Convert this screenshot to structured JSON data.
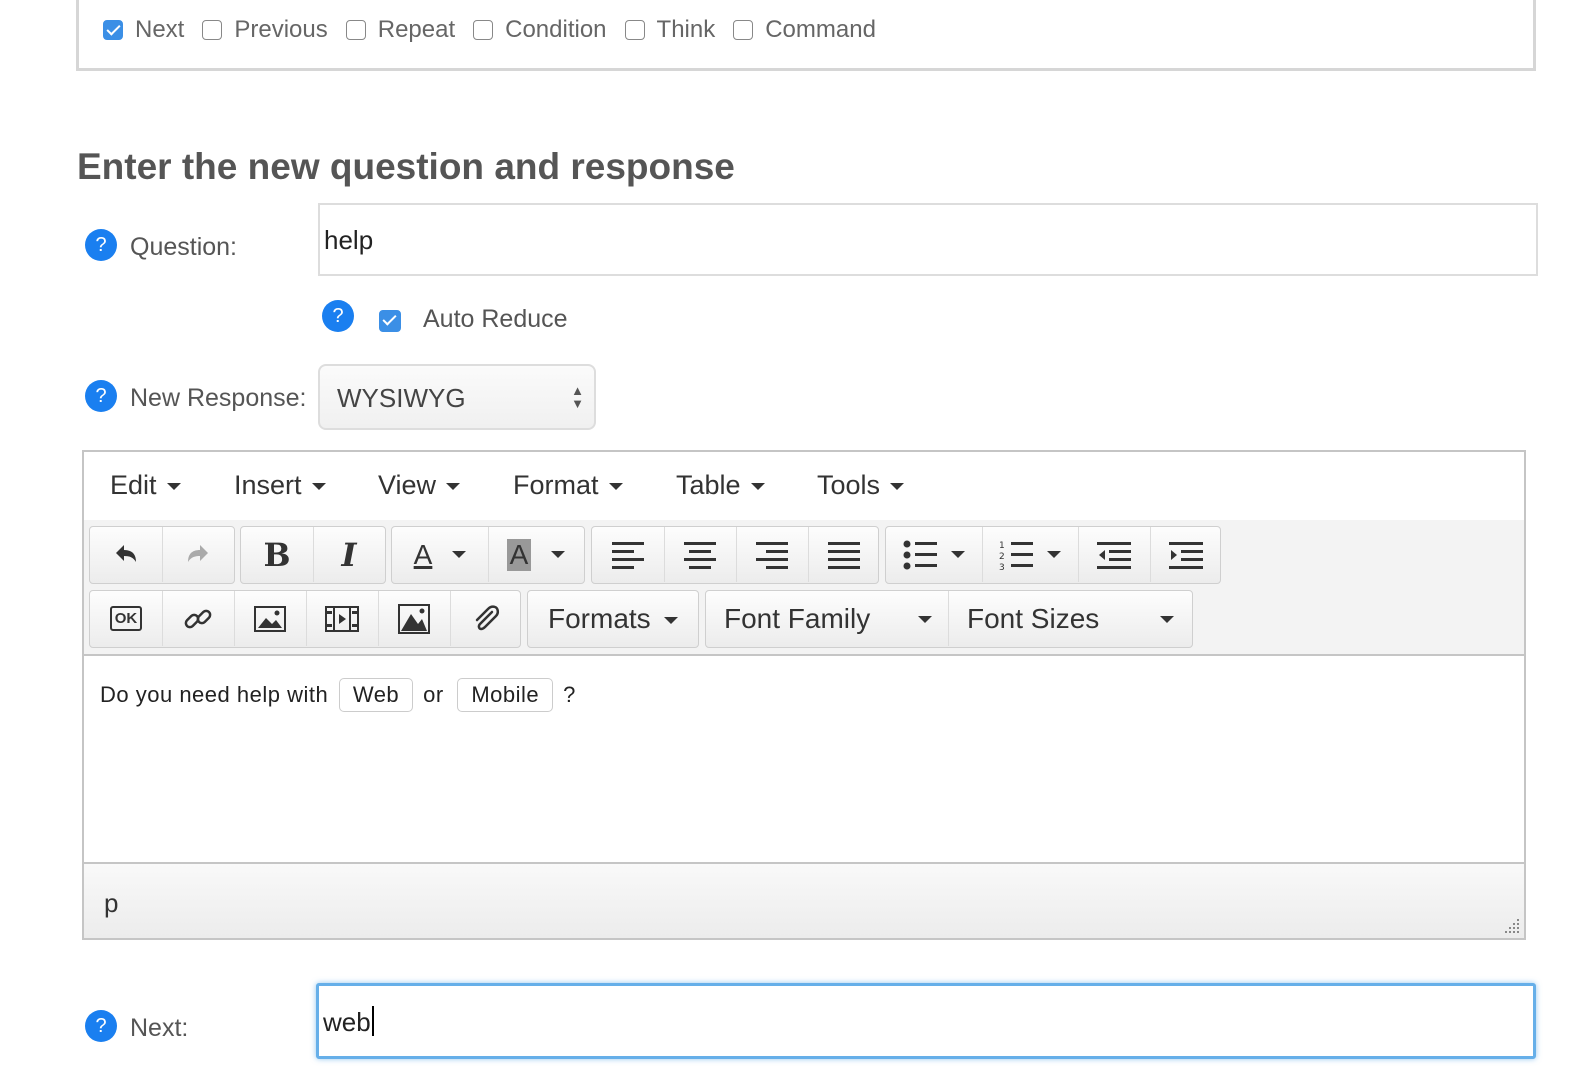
{
  "top_checks": [
    {
      "label": "Next",
      "checked": true
    },
    {
      "label": "Previous",
      "checked": false
    },
    {
      "label": "Repeat",
      "checked": false
    },
    {
      "label": "Condition",
      "checked": false
    },
    {
      "label": "Think",
      "checked": false
    },
    {
      "label": "Command",
      "checked": false
    }
  ],
  "heading": "Enter the new question and response",
  "question": {
    "label": "Question:",
    "value": "help",
    "help_icon": "?"
  },
  "auto_reduce": {
    "label": "Auto Reduce",
    "checked": true,
    "help_icon": "?"
  },
  "new_response": {
    "label": "New Response:",
    "value": "WYSIWYG",
    "help_icon": "?"
  },
  "editor": {
    "menu": [
      "Edit",
      "Insert",
      "View",
      "Format",
      "Table",
      "Tools"
    ],
    "toolbar": {
      "formats": "Formats",
      "font_family": "Font Family",
      "font_sizes": "Font Sizes",
      "bold": "B",
      "italic": "I",
      "font_color": "A",
      "bg_color": "A",
      "ok": "OK"
    },
    "content": {
      "text1": "Do you need help with",
      "button1": "Web",
      "text2": "or",
      "button2": "Mobile",
      "text3": "?"
    },
    "path": "p"
  },
  "next": {
    "label": "Next:",
    "value": "web",
    "help_icon": "?"
  },
  "colors": {
    "accent": "#1a7ff0",
    "focus": "#66afe9"
  }
}
